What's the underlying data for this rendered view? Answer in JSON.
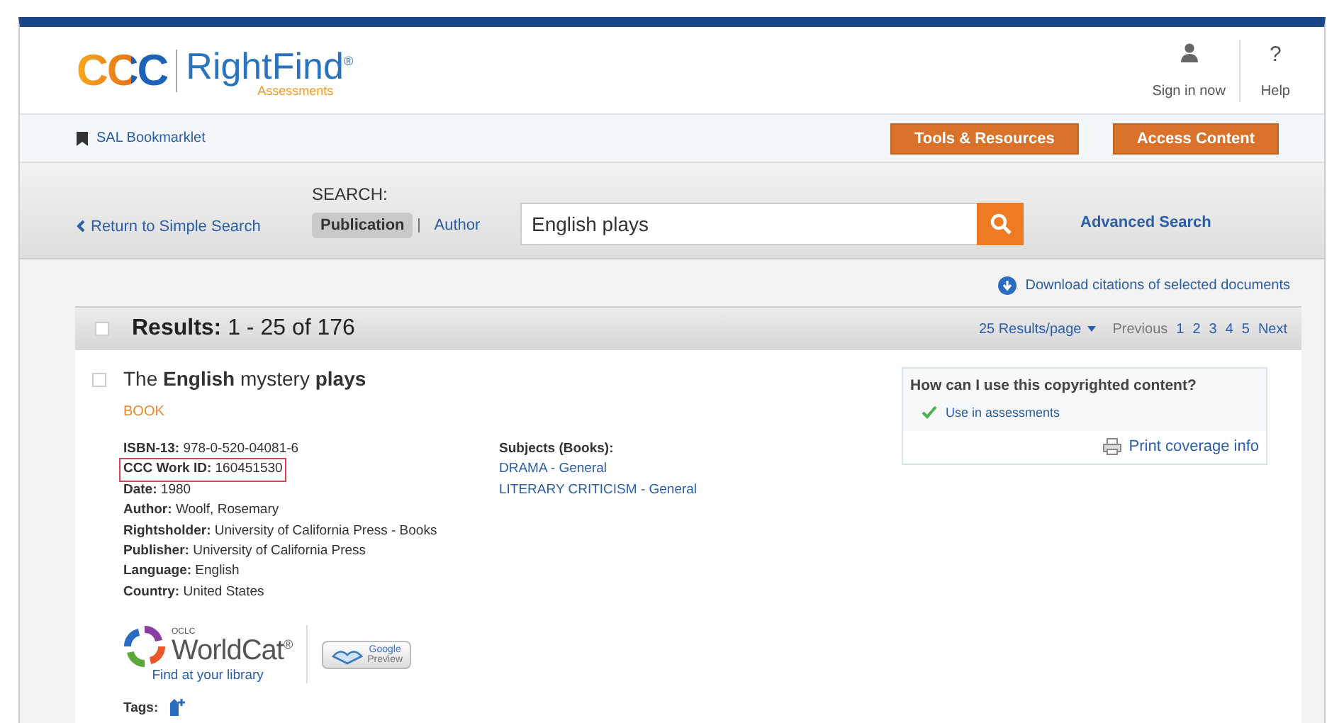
{
  "header": {
    "logo": {
      "mark": "CCC",
      "name": "RightFind",
      "trademark": "®",
      "sub": "Assessments"
    },
    "sign_in": "Sign in now",
    "help": {
      "glyph": "?",
      "label": "Help"
    }
  },
  "nav": {
    "bookmarklet": "SAL Bookmarklet",
    "buttons": [
      "Tools & Resources",
      "Access Content"
    ]
  },
  "search": {
    "back": "Return to Simple Search",
    "label": "SEARCH:",
    "scopes": [
      {
        "label": "Publication",
        "selected": true
      },
      {
        "label": "Author",
        "selected": false
      }
    ],
    "value": "English plays",
    "advanced": "Advanced Search"
  },
  "download": "Download citations of selected documents",
  "results": {
    "select_all": {
      "checked": false
    },
    "label": "Results:",
    "range": "1 - 25 of 176",
    "per_page": "25 Results/page",
    "pager": [
      {
        "label": "Previous",
        "selected": false
      },
      {
        "label": "1",
        "selected": false
      },
      {
        "label": "2",
        "selected": false
      },
      {
        "label": "3",
        "selected": false
      },
      {
        "label": "4",
        "selected": false
      },
      {
        "label": "5",
        "selected": false
      },
      {
        "label": "Next",
        "selected": false
      }
    ]
  },
  "item": {
    "checked": false,
    "title": "The **English** mystery **plays**",
    "type": "BOOK",
    "fields": [
      {
        "label": "ISBN-13:",
        "value": "978-0-520-04081-6",
        "highlighted": false
      },
      {
        "label": "CCC Work ID:",
        "value": "160451530",
        "highlighted": true
      },
      {
        "label": "Date:",
        "value": "1980",
        "highlighted": false
      },
      {
        "label": "Author:",
        "value": "Woolf, Rosemary",
        "highlighted": false
      },
      {
        "label": "Rightsholder:",
        "value": "University of California Press - Books",
        "highlighted": false
      },
      {
        "label": "Publisher:",
        "value": "University of California Press",
        "highlighted": false
      },
      {
        "label": "Language:",
        "value": "English",
        "highlighted": false
      },
      {
        "label": "Country:",
        "value": "United States",
        "highlighted": false
      }
    ],
    "subjects_label": "Subjects (Books):",
    "subjects": [
      "DRAMA - General",
      "LITERARY CRITICISM - General"
    ],
    "usage": {
      "title": "How can I use this copyrighted content?",
      "uses": [
        {
          "label": "Use in assessments",
          "allowed": true
        }
      ],
      "print": "Print coverage info"
    },
    "worldcat": {
      "small": "OCLC",
      "name": "WorldCat",
      "trademark": "®",
      "link": "Find at your library"
    },
    "google": {
      "top": "Google",
      "bottom": "Preview"
    },
    "tags": "Tags:"
  }
}
